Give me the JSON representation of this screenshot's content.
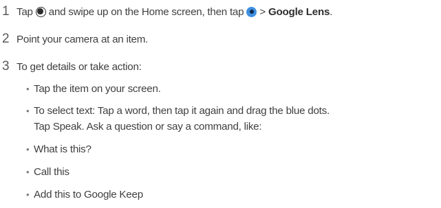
{
  "steps": [
    {
      "num": "1",
      "text_a": "Tap",
      "icon_a": "home-button-icon",
      "text_b": "and swipe up on the Home screen, then tap",
      "icon_b": "google-assistant-icon",
      "text_c": ">",
      "bold": "Google Lens",
      "text_d": "."
    },
    {
      "num": "2",
      "text": "Point your camera at an item."
    },
    {
      "num": "3",
      "text": "To get details or take action:"
    }
  ],
  "bullets": [
    {
      "dot": "•",
      "lines": [
        "Tap the item on your screen."
      ]
    },
    {
      "dot": "•",
      "lines": [
        "To select text: Tap a word, then tap it again and drag the blue dots.",
        "Tap Speak. Ask a question or say a command, like:"
      ]
    },
    {
      "dot": "•",
      "lines": [
        "What is this?"
      ]
    },
    {
      "dot": "•",
      "lines": [
        "Call this"
      ]
    },
    {
      "dot": "•",
      "lines": [
        "Add this to Google Keep"
      ]
    }
  ]
}
